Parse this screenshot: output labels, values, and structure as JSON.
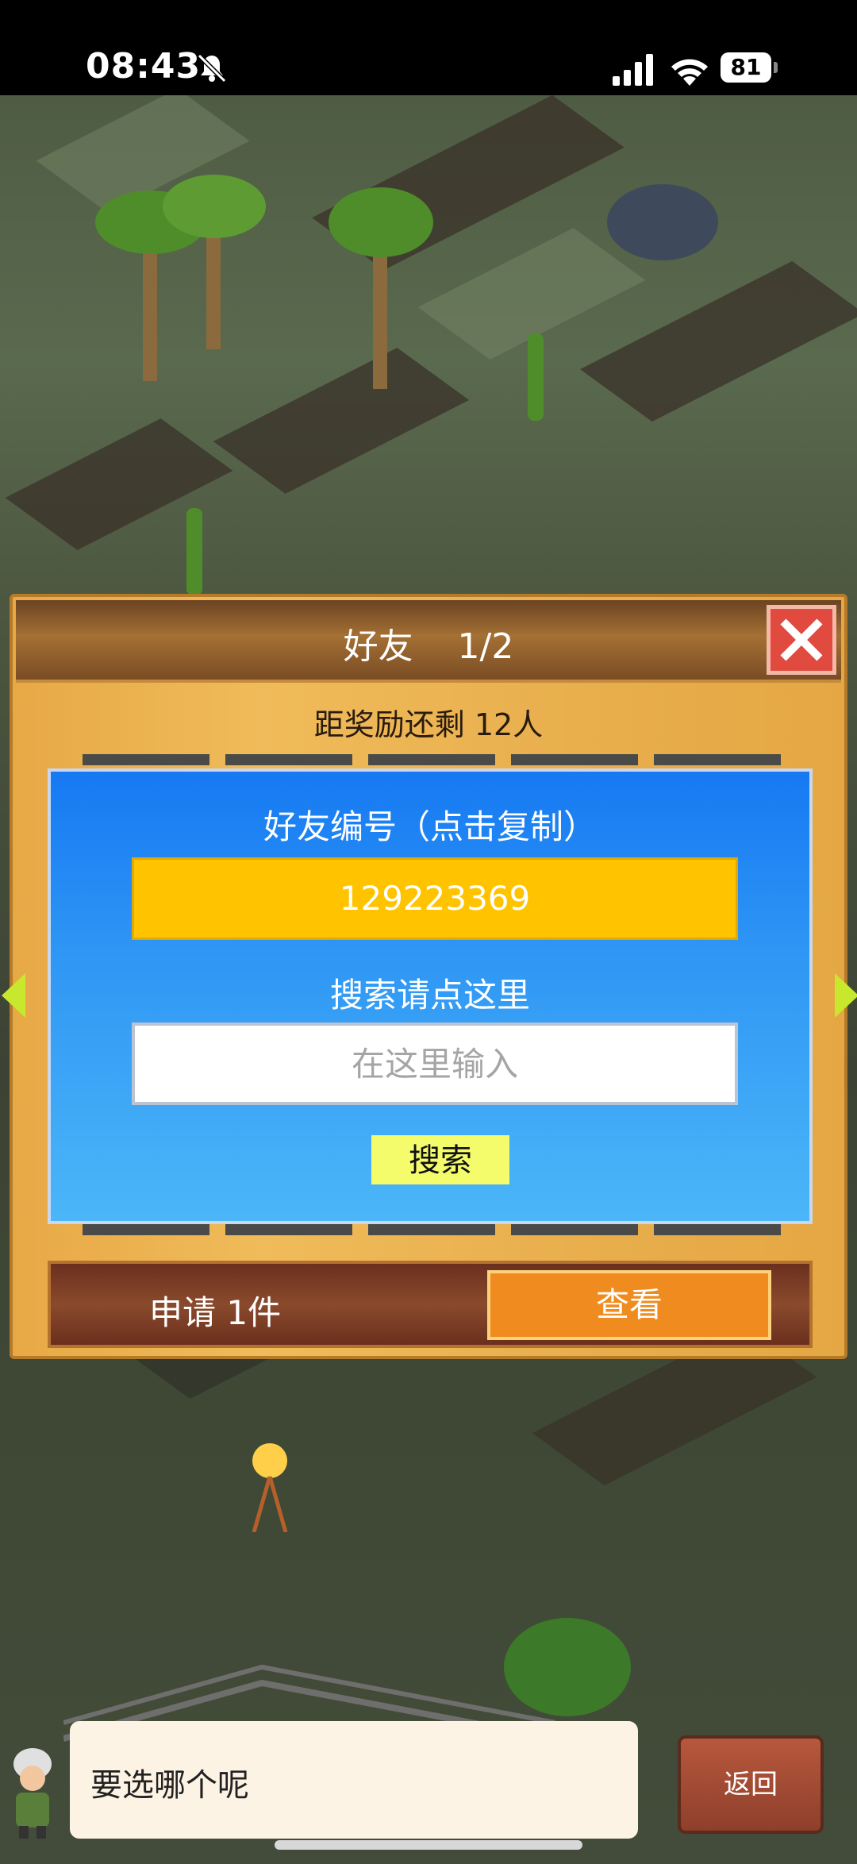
{
  "status_bar": {
    "time": "08:43",
    "battery": "81",
    "icons": [
      "bell-slash-icon",
      "cellular-signal-icon",
      "wifi-icon",
      "battery-icon"
    ]
  },
  "dialog": {
    "title": "好友    1/2",
    "reward_text": "距奖励还剩 12人",
    "friend_id_label": "好友编号（点击复制）",
    "friend_id": "129223369",
    "search_label": "搜索请点这里",
    "search_placeholder": "在这里输入",
    "search_button": "搜索",
    "request_text": "申请 1件",
    "view_button": "查看",
    "close_icon": "close-icon",
    "nav_icons": [
      "chevron-left-icon",
      "chevron-right-icon"
    ]
  },
  "bottom": {
    "speech_text": "要选哪个呢",
    "back_button": "返回"
  },
  "colors": {
    "panel_blue": "#1679f3",
    "id_yellow": "#ffc300",
    "search_button": "#f4fc6c",
    "view_button": "#f08c1f",
    "close_red": "#e04a3f"
  }
}
